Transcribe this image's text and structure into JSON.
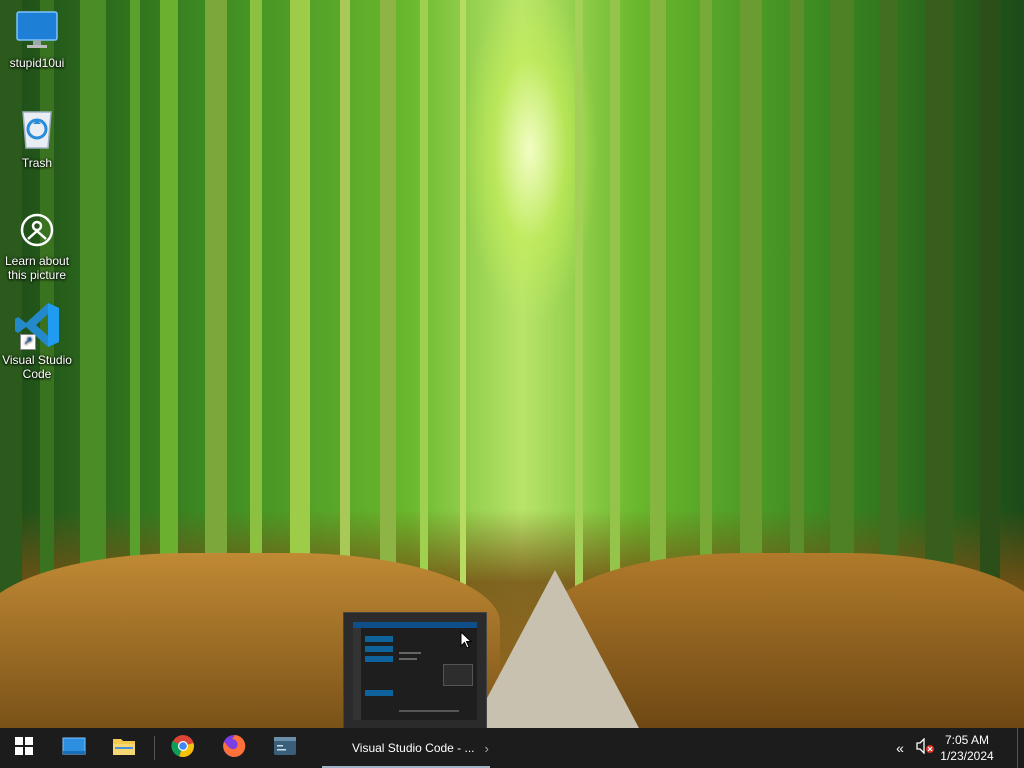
{
  "desktop": {
    "icons": [
      {
        "label": "stupid10ui",
        "icon": "monitor-icon"
      },
      {
        "label": "Trash",
        "icon": "recycle-bin-icon"
      },
      {
        "label": "Learn about this picture",
        "icon": "camera-info-icon"
      },
      {
        "label": "Visual Studio Code",
        "icon": "vscode-icon"
      }
    ],
    "wallpaper": "bamboo-forest-path"
  },
  "taskbar": {
    "start_icon": "windows-logo-icon",
    "pinned": [
      {
        "name": "task-view",
        "icon": "task-view-icon"
      },
      {
        "name": "file-explorer",
        "icon": "folder-icon"
      },
      {
        "name": "chrome",
        "icon": "chrome-icon"
      },
      {
        "name": "firefox",
        "icon": "firefox-icon"
      },
      {
        "name": "terminal",
        "icon": "terminal-icon"
      }
    ],
    "active_window": {
      "label": "Visual Studio Code - ...",
      "chevron": "›"
    },
    "tray": {
      "chevron": "«",
      "volume_icon": "volume-muted-icon"
    },
    "clock": {
      "time": "7:05 AM",
      "date": "1/23/2024"
    }
  },
  "colors": {
    "taskbar_bg": "#1c1c1c",
    "active_underline": "#9fb4c8",
    "vscode_blue": "#2489ca"
  }
}
